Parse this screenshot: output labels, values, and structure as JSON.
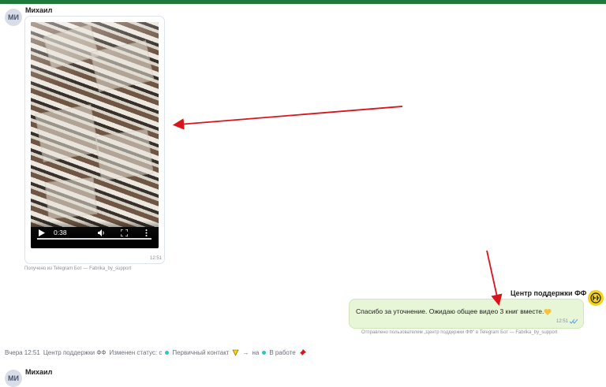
{
  "colors": {
    "topbar": "#1f7a3a",
    "outgoing_bubble": "#e6f6d6",
    "arrow": "#d9141c",
    "status_dot": "#2fc4c4"
  },
  "messages": [
    {
      "avatar_initials": "МИ",
      "sender": "Михаил",
      "attachment": {
        "type": "video",
        "duration": "0:38",
        "icons": [
          "play-icon",
          "volume-icon",
          "fullscreen-icon",
          "more-icon"
        ]
      },
      "time": "12:51",
      "caption": "Получено из Telegram Бот — Fabrika_by_support"
    },
    {
      "sender": "Центр поддержки ФФ",
      "avatar_icon": "bot-logo-icon",
      "text": "Спасибо за уточнение. Ожидаю общее видео 3 книг вместе.",
      "emoji": "yellow-heart-icon",
      "time": "12:51",
      "status_icon": "double-check-icon",
      "caption": "Отправлено пользователем „Центр поддержки ФФ\" в Telegram Бот — Fabrika_by_support"
    }
  ],
  "status_change": {
    "time": "Вчера 12:51",
    "actor": "Центр поддержки ФФ",
    "action": "Изменен статус: с",
    "from_status": "Первичный контакт",
    "arrow": "→",
    "connector": "на",
    "to_status": "В работе"
  },
  "next_message": {
    "avatar_initials": "МИ",
    "sender": "Михаил"
  }
}
